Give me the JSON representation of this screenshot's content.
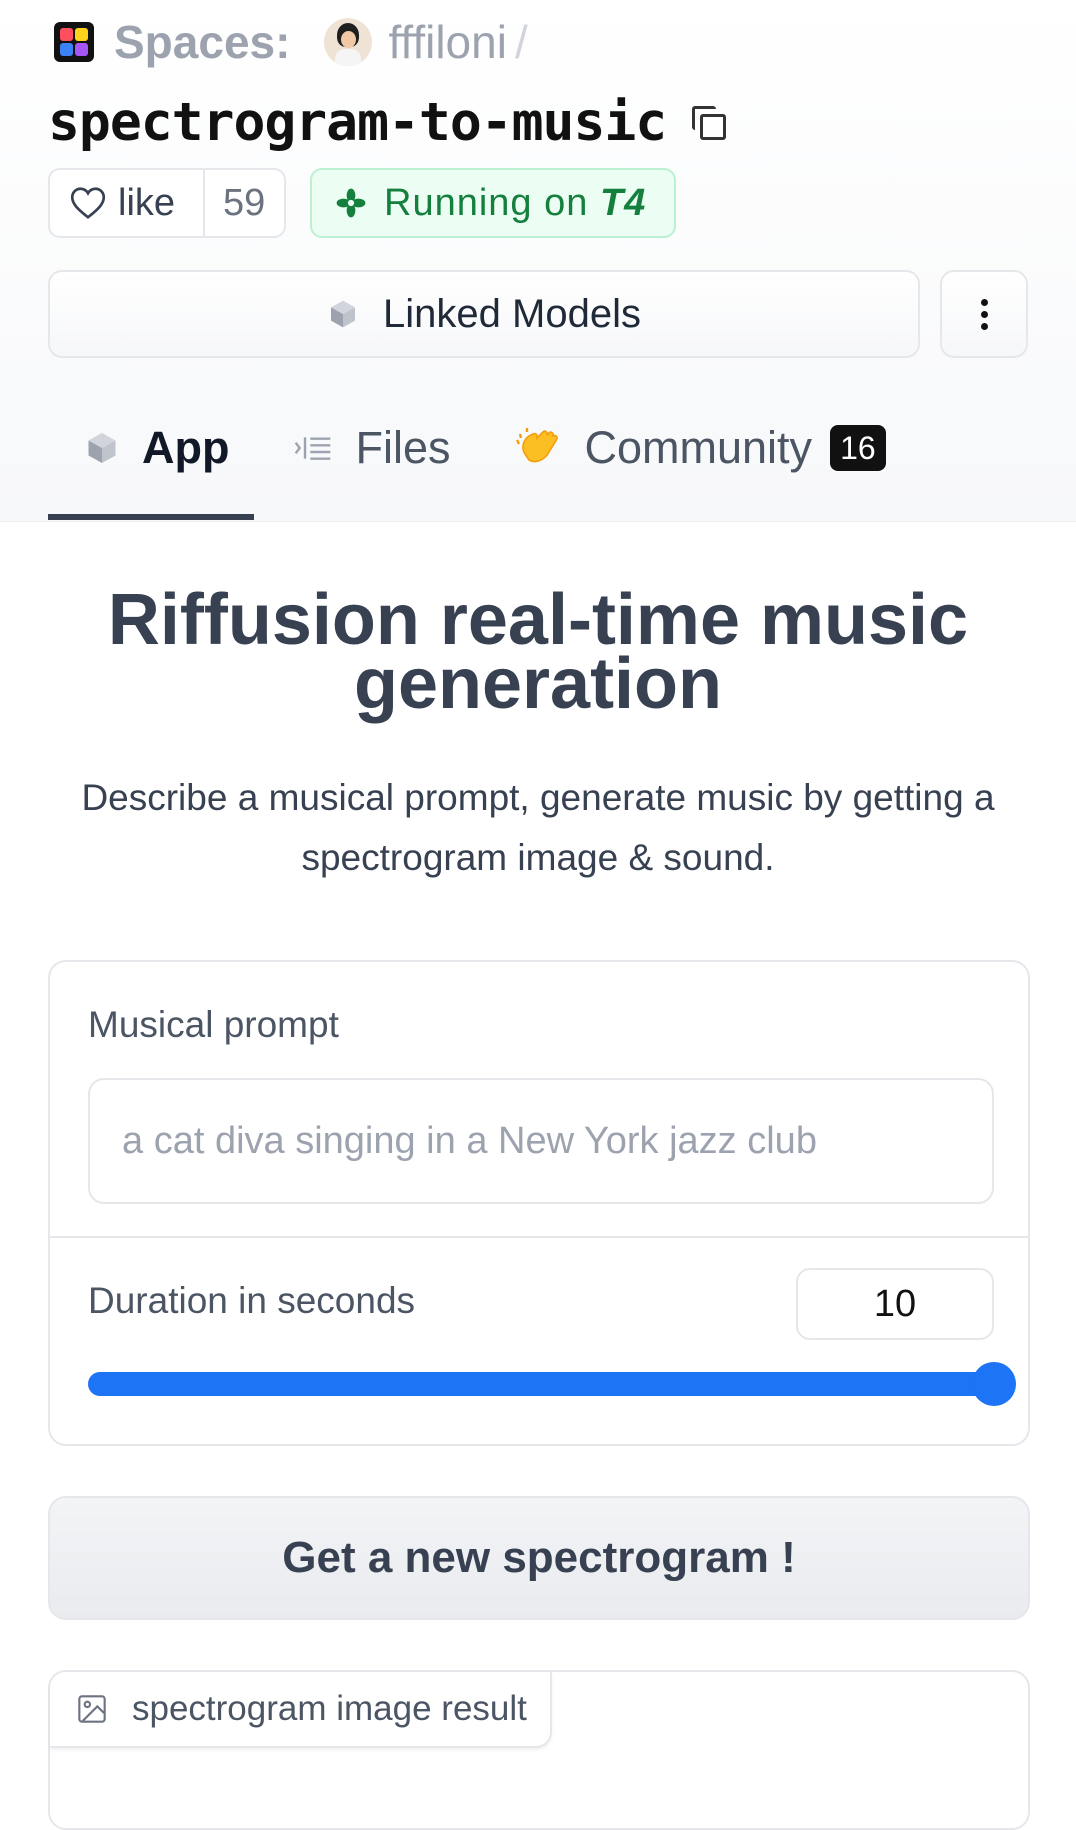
{
  "header": {
    "spaces_label": "Spaces:",
    "owner": "fffiloni",
    "separator": "/",
    "repo_name": "spectrogram-to-music",
    "like_label": "like",
    "like_count": "59",
    "status_prefix": "Running on",
    "status_hardware": "T4",
    "linked_models_label": "Linked Models"
  },
  "tabs": [
    {
      "label": "App",
      "icon": "cube-icon",
      "active": true
    },
    {
      "label": "Files",
      "icon": "files-icon",
      "active": false
    },
    {
      "label": "Community",
      "icon": "clapping-hands-icon",
      "active": false,
      "count": "16"
    }
  ],
  "app": {
    "title": "Riffusion real-time music generation",
    "description": "Describe a musical prompt, generate music by getting a spectrogram image & sound.",
    "prompt_label": "Musical prompt",
    "prompt_placeholder": "a cat diva singing in a New York jazz club",
    "duration_label": "Duration in seconds",
    "duration_value": "10",
    "duration_fraction": 1.0,
    "generate_label": "Get a new spectrogram !",
    "result_label": "spectrogram image result"
  },
  "colors": {
    "accent": "#1d74f5",
    "status_green": "#15803d",
    "status_bg": "#ecfdf3"
  }
}
